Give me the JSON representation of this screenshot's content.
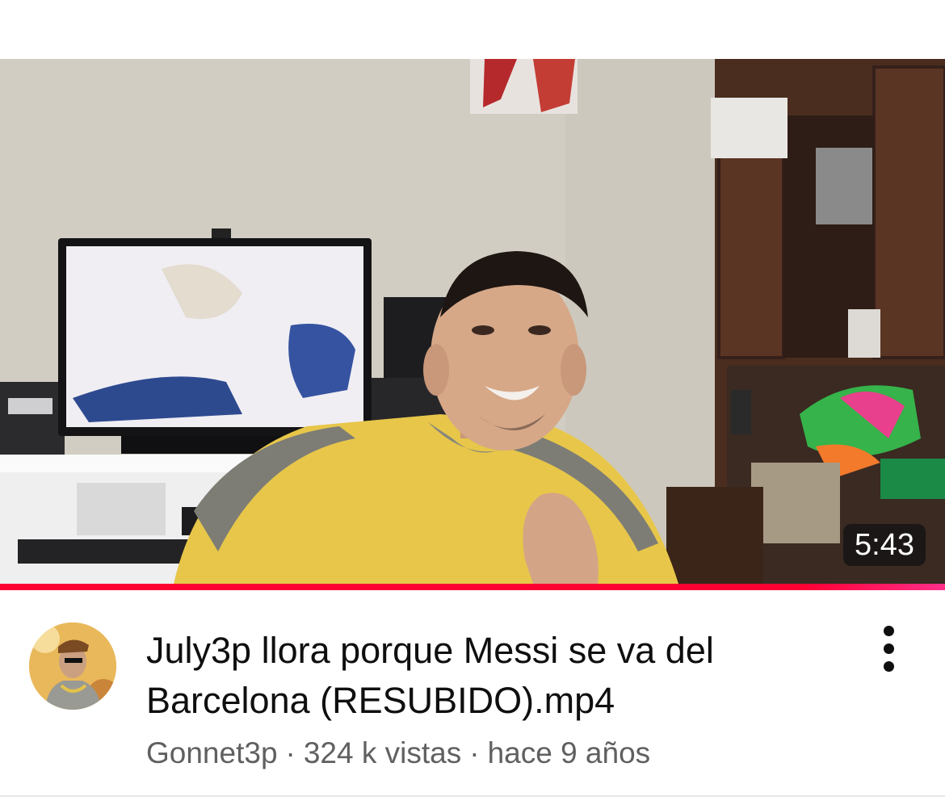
{
  "video": {
    "duration": "5:43",
    "watched_fraction": 1.0,
    "title": "July3p llora porque Messi se va del Barcelona (RESUBIDO).mp4",
    "channel": "Gonnet3p",
    "views": "324 k vistas",
    "age": "hace 9 años",
    "separator": "·"
  },
  "icons": {
    "more": "more-vert-icon",
    "avatar": "channel-avatar"
  },
  "colors": {
    "progress": "#ff0033",
    "title": "#0f0f0f",
    "meta": "#606060"
  }
}
